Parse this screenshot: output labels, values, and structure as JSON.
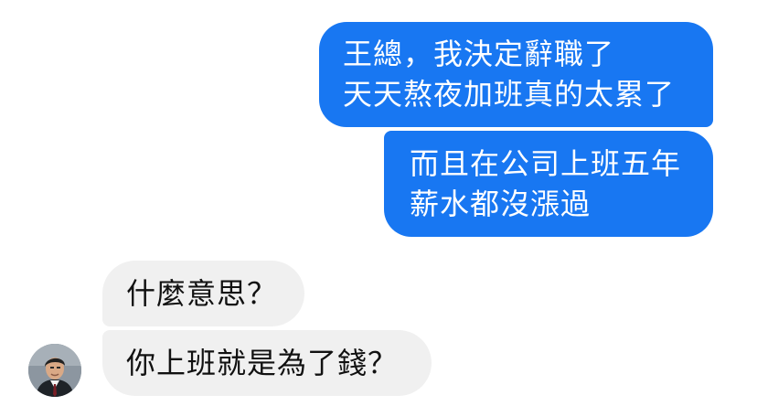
{
  "conversation": {
    "messages": [
      {
        "sender": "me",
        "lines": [
          "王總，我決定辭職了",
          "天天熬夜加班真的太累了"
        ]
      },
      {
        "sender": "me",
        "lines": [
          "而且在公司上班五年",
          "薪水都沒漲過"
        ]
      },
      {
        "sender": "other",
        "lines": [
          "什麼意思？"
        ]
      },
      {
        "sender": "other",
        "lines": [
          "你上班就是為了錢？"
        ]
      }
    ]
  },
  "colors": {
    "outgoing_bubble": "#1877f2",
    "incoming_bubble": "#f0f0f0",
    "outgoing_text": "#ffffff",
    "incoming_text": "#111111"
  },
  "icons": {
    "avatar": "person-avatar-icon"
  }
}
